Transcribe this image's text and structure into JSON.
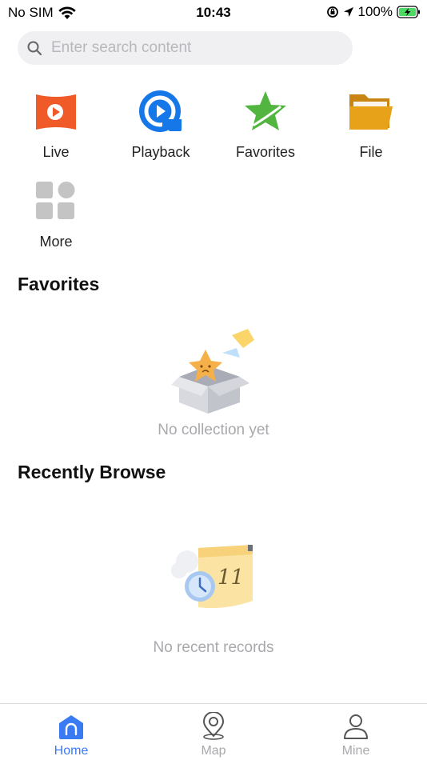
{
  "status_bar": {
    "carrier": "No SIM",
    "time": "10:43",
    "battery": "100%"
  },
  "search": {
    "placeholder": "Enter search content",
    "icon": "search-icon"
  },
  "shortcuts": [
    {
      "label": "Live",
      "icon": "live-icon",
      "color": "#f05a28"
    },
    {
      "label": "Playback",
      "icon": "playback-icon",
      "color": "#1677e8"
    },
    {
      "label": "Favorites",
      "icon": "star-icon",
      "color": "#52b540"
    },
    {
      "label": "File",
      "icon": "folder-icon",
      "color": "#e8a21a"
    },
    {
      "label": "More",
      "icon": "grid-icon",
      "color": "#c4c4c4"
    }
  ],
  "favorites": {
    "title": "Favorites",
    "empty_text": "No collection yet",
    "icon": "empty-box-icon"
  },
  "recent": {
    "title": "Recently Browse",
    "empty_text": "No recent records",
    "icon": "calendar-clock-icon",
    "calendar_number": "11"
  },
  "tabbar": {
    "tabs": [
      {
        "label": "Home",
        "icon": "home-icon",
        "active": true
      },
      {
        "label": "Map",
        "icon": "map-pin-icon",
        "active": false
      },
      {
        "label": "Mine",
        "icon": "person-icon",
        "active": false
      }
    ]
  },
  "colors": {
    "accent": "#3a7af3",
    "muted_text": "#a9a9ad",
    "search_bg": "#f0f0f2"
  }
}
